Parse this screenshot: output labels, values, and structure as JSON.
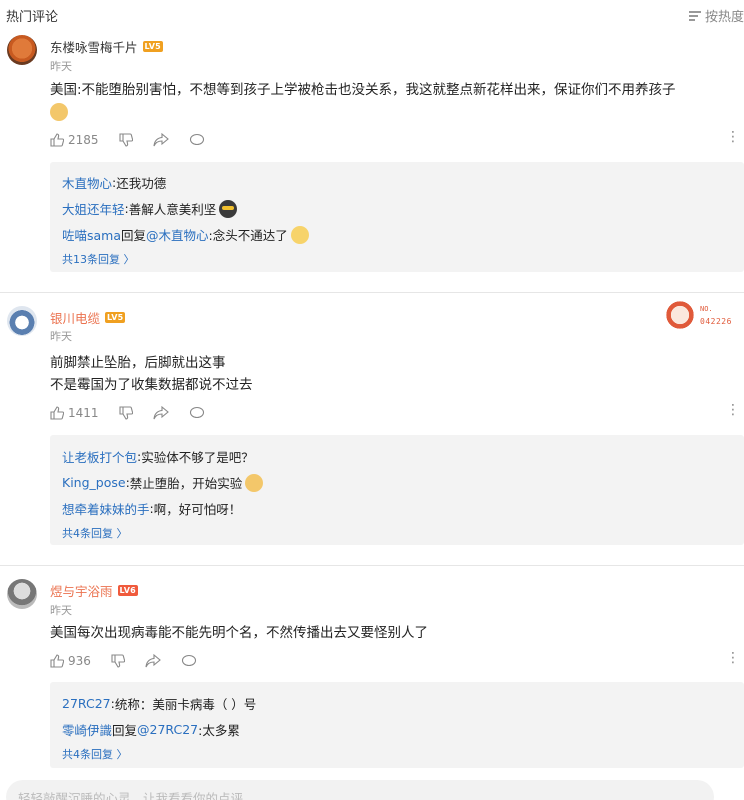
{
  "header": {
    "title": "热门评论",
    "sort_label": "按热度"
  },
  "comments": [
    {
      "user": "东楼咏雪梅千片",
      "level": "LV5",
      "date": "昨天",
      "text": "美国:不能堕胎别害怕，不想等到孩子上学被枪击也没关系，我这就整点新花样出来，保证你们不用养孩子",
      "likes": "2185",
      "replies": [
        {
          "user": "木直物心",
          "sep": ": ",
          "text": "还我功德"
        },
        {
          "user": "大姐还年轻",
          "sep": ": ",
          "text": "善解人意美利坚"
        },
        {
          "user": "咗喵sama",
          "reply_word": " 回复 ",
          "at": "@木直物心",
          "text": " :念头不通达了"
        }
      ],
      "total_replies": "共13条回复"
    },
    {
      "user": "银川电缆",
      "level": "LV5",
      "date": "昨天",
      "text_line1": "前脚禁止坠胎，后脚就出这事",
      "text_line2": "不是霉国为了收集数据都说不过去",
      "likes": "1411",
      "badge": {
        "label": "NO.",
        "number": "042226"
      },
      "replies": [
        {
          "user": "让老板打个包",
          "sep": ": ",
          "text": "实验体不够了是吧？"
        },
        {
          "user": "King_pose",
          "sep": ": ",
          "text": "禁止堕胎，开始实验"
        },
        {
          "user": "想牵着妹妹的手",
          "sep": ": ",
          "text": "啊，好可怕呀！"
        }
      ],
      "total_replies": "共4条回复"
    },
    {
      "user": "煜与宇浴雨",
      "level": "LV6",
      "date": "昨天",
      "text": "美国每次出现病毒能不能先明个名，不然传播出去又要怪别人了",
      "likes": "936",
      "replies": [
        {
          "user": "27RC27",
          "sep": ": ",
          "text": "统称：美丽卡病毒（ ）号"
        },
        {
          "user": "零崎伊識",
          "reply_word": " 回复 ",
          "at": "@27RC27",
          "text": " :太多累"
        }
      ],
      "total_replies": "共4条回复"
    }
  ],
  "input": {
    "placeholder": "轻轻敲醒沉睡的心灵，让我看看你的点评"
  },
  "colors": {
    "link": "#2a6fbf",
    "level_badge": "#f0a020",
    "username_highlight": "#eb7350"
  },
  "icons": [
    "sort-icon",
    "like-icon",
    "dislike-icon",
    "share-icon",
    "comment-icon",
    "more-icon",
    "chevron-right-icon"
  ]
}
